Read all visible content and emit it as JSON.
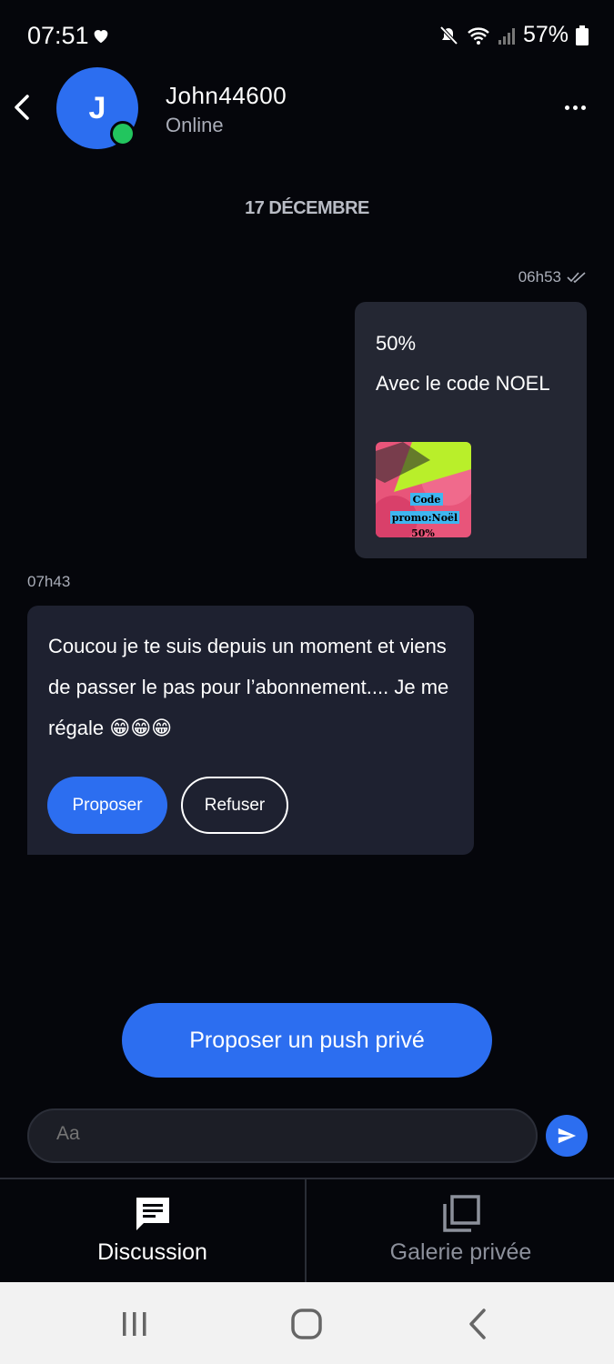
{
  "status_bar": {
    "time": "07:51",
    "battery": "57%",
    "icons": [
      "heart-icon",
      "mute-icon",
      "wifi-icon",
      "signal-icon",
      "battery-icon"
    ]
  },
  "header": {
    "avatar_letter": "J",
    "username": "John44600",
    "presence": "Online",
    "colors": {
      "avatar": "#2c6ef0",
      "online": "#22c55e"
    }
  },
  "date_separator": "17 DÉCEMBRE",
  "messages": {
    "sent": {
      "time": "06h53",
      "line1": "50%",
      "line2": "Avec le code NOEL",
      "image_text": [
        "Code",
        "promo:Noël",
        "50%"
      ]
    },
    "received": {
      "time": "07h43",
      "text": "Coucou je te suis depuis un moment et viens de passer le pas pour l’abonnement.... Je me régale 😁😁😁",
      "propose_label": "Proposer",
      "refuse_label": "Refuser"
    }
  },
  "push_button": "Proposer un push privé",
  "composer": {
    "placeholder": "Aa"
  },
  "tabs": [
    {
      "label": "Discussion",
      "icon": "chat-icon",
      "active": true
    },
    {
      "label": "Galerie privée",
      "icon": "gallery-icon",
      "active": false
    }
  ],
  "accent_color": "#2c6ef0"
}
